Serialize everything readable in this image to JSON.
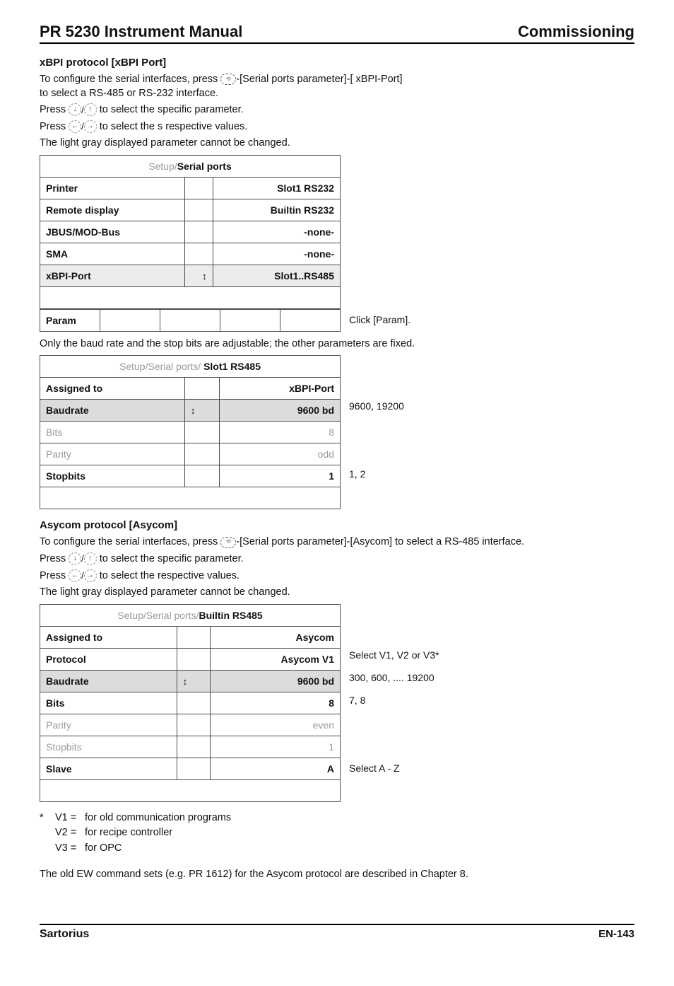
{
  "header": {
    "left": "PR 5230 Instrument Manual",
    "right": "Commissioning"
  },
  "sec1": {
    "heading": "xBPI protocol [xBPI Port]",
    "intro1_a": "To configure the serial interfaces, press ",
    "intro1_b": "-[Serial ports parameter]-[ xBPI-Port]",
    "intro1_c": "to select a RS-485 or RS-232 interface.",
    "intro2_a": "Press ",
    "intro2_b": " to select the specific parameter.",
    "intro3_a": "Press ",
    "intro3_b": " to select the s respective values.",
    "intro4": "The light gray displayed parameter cannot be changed."
  },
  "panel1": {
    "title_muted": "Setup/",
    "title_bold": "Serial ports",
    "rows": [
      {
        "label": "Printer",
        "value": "Slot1  RS232",
        "bold": true
      },
      {
        "label": "Remote display",
        "value": "Builtin  RS232",
        "bold": true
      },
      {
        "label": "JBUS/MOD-Bus",
        "value": "-none-",
        "bold": true
      },
      {
        "label": "SMA",
        "value": "-none-",
        "bold": true
      },
      {
        "label": "xBPI-Port",
        "value": "Slot1..RS485",
        "bold": true,
        "shaded": true,
        "arrows": true
      }
    ],
    "softkeys": [
      "Param",
      "",
      "",
      "",
      ""
    ],
    "anno_soft": "Click [Param]."
  },
  "mid_note": "Only the baud rate and the stop bits are adjustable; the other parameters are fixed.",
  "panel2": {
    "title_muted": "Setup/Serial ports/ ",
    "title_bold": "Slot1  RS485",
    "rows": [
      {
        "label": "Assigned to",
        "value": "xBPI-Port",
        "bold": true,
        "anno": ""
      },
      {
        "label": "Baudrate",
        "value": "9600  bd",
        "bold": true,
        "shaded": true,
        "arrows": true,
        "anno": "9600, 19200"
      },
      {
        "label": "Bits",
        "value": "8",
        "muted": true,
        "anno": ""
      },
      {
        "label": "Parity",
        "value": "odd",
        "muted": true,
        "anno": ""
      },
      {
        "label": "Stopbits",
        "value": "1",
        "bold": true,
        "anno": "1, 2"
      }
    ]
  },
  "sec2": {
    "heading": "Asycom protocol [Asycom]",
    "intro1_a": "To configure the serial interfaces, press ",
    "intro1_b": "-[Serial ports parameter]-[Asycom] to select a RS-485 interface.",
    "intro2_a": "Press ",
    "intro2_b": " to select the specific parameter.",
    "intro3_a": "Press ",
    "intro3_b": " to select the respective values.",
    "intro4": "The light gray displayed parameter cannot be changed."
  },
  "panel3": {
    "title_muted": "Setup/Serial ports/",
    "title_bold": "Builtin RS485",
    "rows": [
      {
        "label": "Assigned to",
        "value": "Asycom",
        "bold": true,
        "anno": ""
      },
      {
        "label": "Protocol",
        "value": "Asycom V1",
        "bold": true,
        "anno": "Select V1, V2 or V3*"
      },
      {
        "label": "Baudrate",
        "value": "9600 bd",
        "bold": true,
        "shaded": true,
        "arrows": true,
        "anno": "300, 600, .... 19200"
      },
      {
        "label": "Bits",
        "value": "8",
        "bold": true,
        "anno": "7, 8"
      },
      {
        "label": "Parity",
        "value": "even",
        "muted": true,
        "anno": ""
      },
      {
        "label": "Stopbits",
        "value": "1",
        "muted": true,
        "anno": ""
      },
      {
        "label": "Slave",
        "value": "A",
        "bold": true,
        "anno": "Select A - Z"
      }
    ]
  },
  "defs": [
    {
      "star": "*",
      "sym": "V1 =",
      "text": "for old communication programs"
    },
    {
      "star": "",
      "sym": "V2 =",
      "text": "for recipe controller"
    },
    {
      "star": "",
      "sym": "V3 =",
      "text": "for OPC"
    }
  ],
  "closing": "The old EW command sets (e.g. PR 1612) for the Asycom protocol are described in Chapter 8.",
  "footer": {
    "left": "Sartorius",
    "right": "EN-143"
  }
}
